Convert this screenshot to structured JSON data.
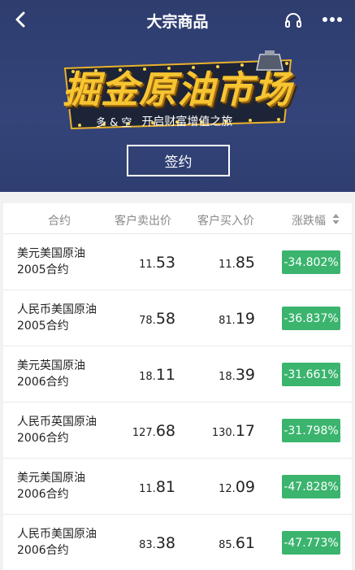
{
  "nav": {
    "title": "大宗商品",
    "icons": [
      "back-arrow-icon",
      "headset-icon",
      "more-dots-icon"
    ]
  },
  "banner": {
    "title": "掘金原油市场",
    "direction": "多 & 空",
    "slogan": "开启财富增值之旅",
    "sign_label": "签约"
  },
  "table": {
    "headers": {
      "contract": "合约",
      "sell": "客户卖出价",
      "buy": "客户买入价",
      "change": "涨跌幅"
    },
    "rows": [
      {
        "name_line1": "美元美国原油",
        "name_line2": "2005合约",
        "sell_int": "11.",
        "sell_dec": "53",
        "buy_int": "11.",
        "buy_dec": "85",
        "change": "-34.802%"
      },
      {
        "name_line1": "人民币美国原油",
        "name_line2": "2005合约",
        "sell_int": "78.",
        "sell_dec": "58",
        "buy_int": "81.",
        "buy_dec": "19",
        "change": "-36.837%"
      },
      {
        "name_line1": "美元英国原油",
        "name_line2": "2006合约",
        "sell_int": "18.",
        "sell_dec": "11",
        "buy_int": "18.",
        "buy_dec": "39",
        "change": "-31.661%"
      },
      {
        "name_line1": "人民币英国原油",
        "name_line2": "2006合约",
        "sell_int": "127.",
        "sell_dec": "68",
        "buy_int": "130.",
        "buy_dec": "17",
        "change": "-31.798%"
      },
      {
        "name_line1": "美元美国原油",
        "name_line2": "2006合约",
        "sell_int": "11.",
        "sell_dec": "81",
        "buy_int": "12.",
        "buy_dec": "09",
        "change": "-47.828%"
      },
      {
        "name_line1": "人民币美国原油",
        "name_line2": "2006合约",
        "sell_int": "83.",
        "sell_dec": "38",
        "buy_int": "85.",
        "buy_dec": "61",
        "change": "-47.773%"
      }
    ]
  },
  "colors": {
    "header_bg": "#34447a",
    "banner_gold": "#f7c531",
    "change_green": "#3bb46e"
  }
}
